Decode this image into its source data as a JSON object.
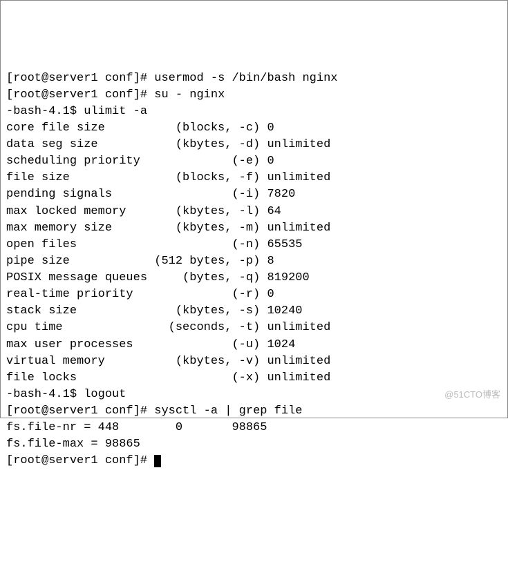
{
  "lines": {
    "l1_prompt": "[root@server1 conf]# ",
    "l1_cmd": "usermod -s /bin/bash nginx",
    "l2_prompt": "[root@server1 conf]# ",
    "l2_cmd": "su - nginx",
    "l3_prompt": "-bash-4.1$ ",
    "l3_cmd": "ulimit -a",
    "u1_name": "core file size          ",
    "u1_unit": "(blocks, -c) ",
    "u1_val": "0",
    "u2_name": "data seg size           ",
    "u2_unit": "(kbytes, -d) ",
    "u2_val": "unlimited",
    "u3_name": "scheduling priority             ",
    "u3_unit": "(-e) ",
    "u3_val": "0",
    "u4_name": "file size               ",
    "u4_unit": "(blocks, -f) ",
    "u4_val": "unlimited",
    "u5_name": "pending signals                 ",
    "u5_unit": "(-i) ",
    "u5_val": "7820",
    "u6_name": "max locked memory       ",
    "u6_unit": "(kbytes, -l) ",
    "u6_val": "64",
    "u7_name": "max memory size         ",
    "u7_unit": "(kbytes, -m) ",
    "u7_val": "unlimited",
    "u8_name": "open files                      ",
    "u8_unit": "(-n) ",
    "u8_val": "65535",
    "u9_name": "pipe size            ",
    "u9_unit": "(512 bytes, -p) ",
    "u9_val": "8",
    "u10_name": "POSIX message queues     ",
    "u10_unit": "(bytes, -q) ",
    "u10_val": "819200",
    "u11_name": "real-time priority              ",
    "u11_unit": "(-r) ",
    "u11_val": "0",
    "u12_name": "stack size              ",
    "u12_unit": "(kbytes, -s) ",
    "u12_val": "10240",
    "u13_name": "cpu time               ",
    "u13_unit": "(seconds, -t) ",
    "u13_val": "unlimited",
    "u14_name": "max user processes              ",
    "u14_unit": "(-u) ",
    "u14_val": "1024",
    "u15_name": "virtual memory          ",
    "u15_unit": "(kbytes, -v) ",
    "u15_val": "unlimited",
    "u16_name": "file locks                      ",
    "u16_unit": "(-x) ",
    "u16_val": "unlimited",
    "l20_prompt": "-bash-4.1$ ",
    "l20_cmd": "logout",
    "l21_prompt": "[root@server1 conf]# ",
    "l21_cmd": "sysctl -a | grep file",
    "l22": "fs.file-nr = 448        0       98865",
    "l23": "fs.file-max = 98865",
    "l24_prompt": "[root@server1 conf]# ",
    "wm": "@51CTO博客"
  }
}
